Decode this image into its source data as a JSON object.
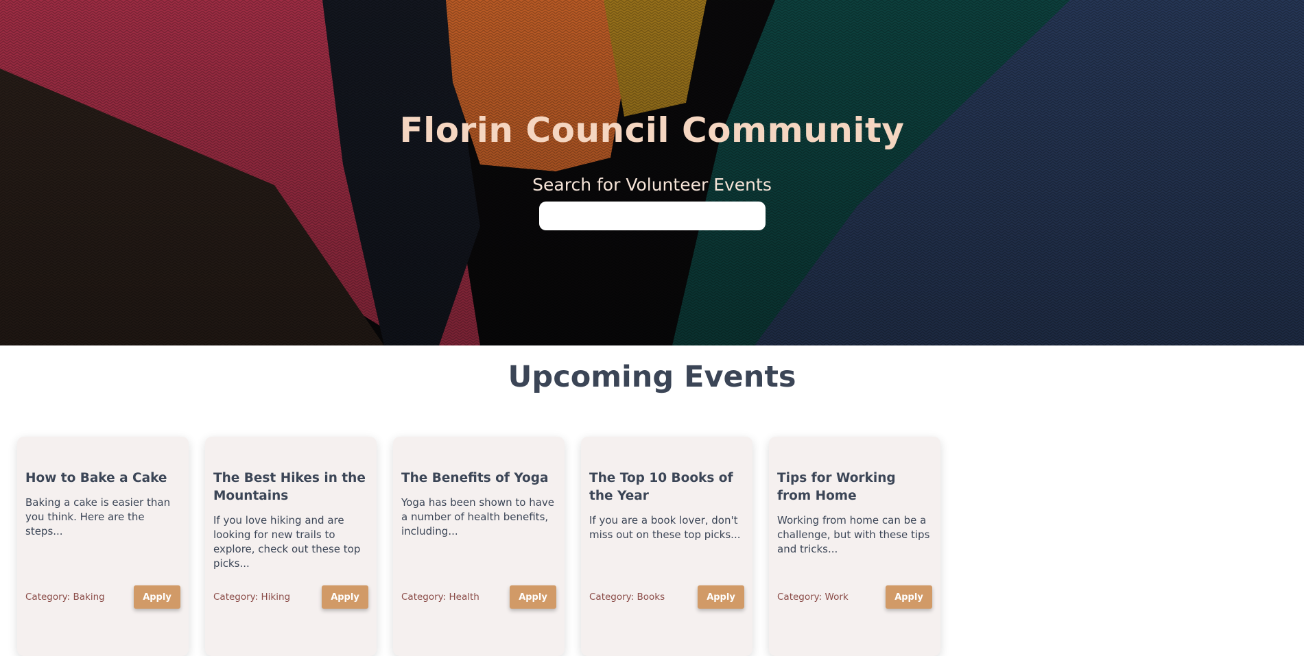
{
  "hero": {
    "title": "Florin Council Community",
    "search_label": "Search for Volunteer Events",
    "search_value": "",
    "search_placeholder": ""
  },
  "events_section": {
    "title": "Upcoming Events",
    "cards": [
      {
        "title": "How to Bake a Cake",
        "description": "Baking a cake is easier than you think. Here are the steps...",
        "category": "Category: Baking",
        "button": "Apply"
      },
      {
        "title": "The Best Hikes in the Mountains",
        "description": "If you love hiking and are looking for new trails to explore, check out these top picks...",
        "category": "Category: Hiking",
        "button": "Apply"
      },
      {
        "title": "The Benefits of Yoga",
        "description": "Yoga has been shown to have a number of health benefits, including...",
        "category": "Category: Health",
        "button": "Apply"
      },
      {
        "title": "The Top 10 Books of the Year",
        "description": "If you are a book lover, don't miss out on these top picks...",
        "category": "Category: Books",
        "button": "Apply"
      },
      {
        "title": "Tips for Working from Home",
        "description": "Working from home can be a challenge, but with these tips and tricks...",
        "category": "Category: Work",
        "button": "Apply"
      }
    ]
  },
  "colors": {
    "hero_title": "#f5d6c1",
    "heading": "#3b4556",
    "card_bg": "#f5f0ef",
    "category_text": "#8a4b47",
    "apply_button": "#d19a67"
  }
}
